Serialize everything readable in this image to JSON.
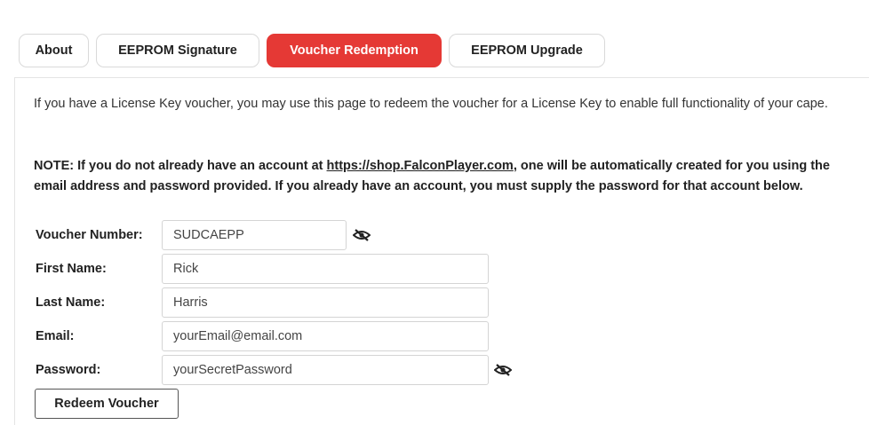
{
  "tabs": [
    {
      "label": "About",
      "active": false
    },
    {
      "label": "EEPROM Signature",
      "active": false
    },
    {
      "label": "Voucher Redemption",
      "active": true
    },
    {
      "label": "EEPROM Upgrade",
      "active": false
    }
  ],
  "intro_text": "If you have a License Key voucher, you may use this page to redeem the voucher for a License Key to enable full functionality of your cape.",
  "note": {
    "prefix": "NOTE: If you do not already have an account at ",
    "link": "https://shop.FalconPlayer.com",
    "suffix": ", one will be automatically created for you using the email address and password provided. If you already have an account, you must supply the password for that account below."
  },
  "form": {
    "voucher": {
      "label": "Voucher Number:",
      "value": "SUDCAEPP",
      "icon": "eye-slash-icon"
    },
    "first_name": {
      "label": "First Name:",
      "value": "Rick"
    },
    "last_name": {
      "label": "Last Name:",
      "value": "Harris"
    },
    "email": {
      "label": "Email:",
      "value": "yourEmail@email.com"
    },
    "password": {
      "label": "Password:",
      "value": "yourSecretPassword",
      "icon": "eye-slash-icon"
    }
  },
  "redeem_button": "Redeem Voucher",
  "colors": {
    "active_tab": "#e53935",
    "border": "#d4d4d4"
  }
}
